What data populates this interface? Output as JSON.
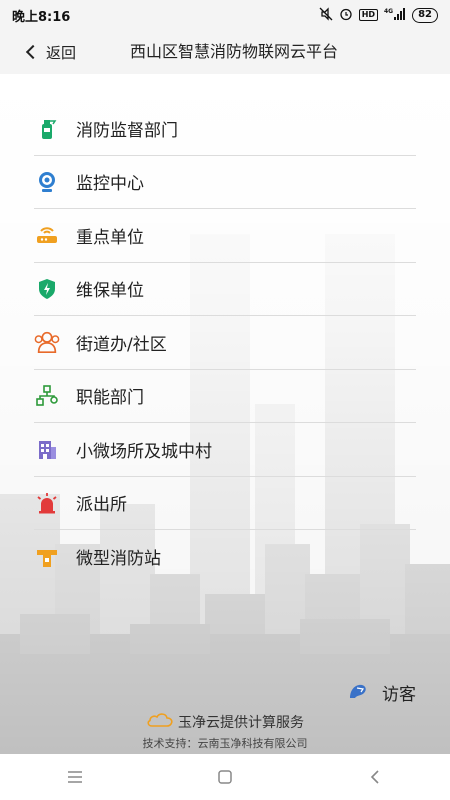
{
  "status_bar": {
    "time": "晚上8:16",
    "network": "4G",
    "hd": "HD",
    "battery": "82"
  },
  "header": {
    "back_label": "返回",
    "title": "西山区智慧消防物联网云平台"
  },
  "menu": {
    "items": [
      {
        "label": "消防监督部门",
        "icon": "fire-extinguisher-icon",
        "color": "#1aa96a"
      },
      {
        "label": "监控中心",
        "icon": "camera-icon",
        "color": "#2f7fd0"
      },
      {
        "label": "重点单位",
        "icon": "router-icon",
        "color": "#f0a020"
      },
      {
        "label": "维保单位",
        "icon": "shield-icon",
        "color": "#1aa96a"
      },
      {
        "label": "街道办/社区",
        "icon": "community-icon",
        "color": "#e86a2a"
      },
      {
        "label": "职能部门",
        "icon": "org-chart-icon",
        "color": "#2e9a3a"
      },
      {
        "label": "小微场所及城中村",
        "icon": "building-icon",
        "color": "#7b6cc9"
      },
      {
        "label": "派出所",
        "icon": "siren-icon",
        "color": "#e23a3a"
      },
      {
        "label": "微型消防站",
        "icon": "station-icon",
        "color": "#f0a020"
      }
    ]
  },
  "visitor": {
    "label": "访客",
    "icon": "visitor-icon"
  },
  "footer": {
    "service": "玉净云提供计算服务",
    "support": "技术支持：云南玉净科技有限公司"
  }
}
